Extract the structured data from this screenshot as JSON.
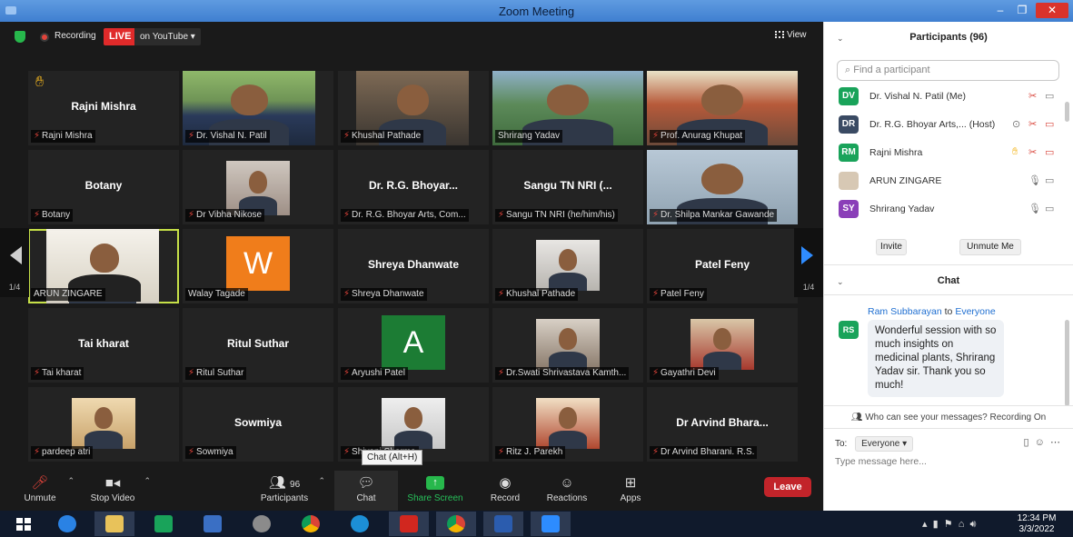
{
  "window": {
    "title": "Zoom Meeting",
    "min": "–",
    "max": "❐",
    "close": "✕"
  },
  "top_bar": {
    "recording": "Recording",
    "live": "LIVE",
    "youtube": "on YouTube ▾",
    "view": "View"
  },
  "tiles": [
    {
      "center": "Rajni Mishra",
      "label": "Rajni Mishra",
      "muted": true,
      "hand": true
    },
    {
      "center": "",
      "label": "Dr. Vishal N. Patil",
      "muted": true
    },
    {
      "center": "",
      "label": "Khushal Pathade",
      "muted": true
    },
    {
      "center": "",
      "label": "Shrirang Yadav",
      "muted": false
    },
    {
      "center": "",
      "label": "Prof. Anurag Khupat",
      "muted": true
    },
    {
      "center": "Botany",
      "label": "Botany",
      "muted": true
    },
    {
      "center": "",
      "label": "Dr Vibha Nikose",
      "muted": true
    },
    {
      "center": "Dr. R.G. Bhoyar...",
      "label": "Dr. R.G. Bhoyar Arts, Com...",
      "muted": true
    },
    {
      "center": "Sangu TN NRI (...",
      "label": "Sangu TN NRI (he/him/his)",
      "muted": true
    },
    {
      "center": "",
      "label": "Dr. Shilpa Mankar Gawande",
      "muted": true
    },
    {
      "center": "",
      "label": "ARUN ZINGARE",
      "muted": false
    },
    {
      "center": "",
      "label": "Walay Tagade",
      "muted": false,
      "letter": "W"
    },
    {
      "center": "Shreya Dhanwate",
      "label": "Shreya Dhanwate",
      "muted": true
    },
    {
      "center": "",
      "label": "Khushal Pathade",
      "muted": true
    },
    {
      "center": "Patel Feny",
      "label": "Patel Feny",
      "muted": true
    },
    {
      "center": "Tai kharat",
      "label": "Tai kharat",
      "muted": true
    },
    {
      "center": "Ritul Suthar",
      "label": "Ritul Suthar",
      "muted": true
    },
    {
      "center": "",
      "label": "Aryushi Patel",
      "muted": true,
      "letter": "A"
    },
    {
      "center": "",
      "label": "Dr.Swati Shrivastava Kamth...",
      "muted": true
    },
    {
      "center": "",
      "label": "Gayathri Devi",
      "muted": true
    },
    {
      "center": "",
      "label": "pardeep atri",
      "muted": true
    },
    {
      "center": "Sowmiya",
      "label": "Sowmiya",
      "muted": true
    },
    {
      "center": "",
      "label": "Shivani Sharma",
      "muted": true
    },
    {
      "center": "",
      "label": "Ritz J. Parekh",
      "muted": true
    },
    {
      "center": "Dr Arvind Bhara...",
      "label": "Dr Arvind Bharani. R.S.",
      "muted": true
    }
  ],
  "paging": {
    "left": "1/4",
    "right": "1/4"
  },
  "toolbar": {
    "unmute": "Unmute",
    "stop_video": "Stop Video",
    "participants": "Participants",
    "participants_count": "96",
    "chat": "Chat",
    "share": "Share Screen",
    "record": "Record",
    "reactions": "Reactions",
    "apps": "Apps",
    "leave": "Leave",
    "tooltip": "Chat (Alt+H)"
  },
  "participants_panel": {
    "title": "Participants (96)",
    "search_placeholder": "Find a participant",
    "rows": [
      {
        "initials": "DV",
        "color": "#19a35a",
        "name": "Dr. Vishal N. Patil (Me)"
      },
      {
        "initials": "DR",
        "color": "#3a4a63",
        "name": "Dr. R.G. Bhoyar Arts,... (Host)"
      },
      {
        "initials": "RM",
        "color": "#19a35a",
        "name": "Rajni Mishra"
      },
      {
        "initials": "",
        "color": "#d7c8b4",
        "name": "ARUN ZINGARE"
      },
      {
        "initials": "SY",
        "color": "#8a3fb8",
        "name": "Shrirang Yadav"
      }
    ],
    "invite": "Invite",
    "unmute_me": "Unmute Me"
  },
  "chat_panel": {
    "title": "Chat",
    "from": "Ram Subbarayan",
    "to_word": "to",
    "to": "Everyone",
    "sender_initials": "RS",
    "message": "Wonderful session with so much insights on medicinal plants, Shrirang Yadav sir. Thank you so much!",
    "notice": "Who can see your messages? Recording On",
    "to_label": "To:",
    "to_select": "Everyone ▾",
    "placeholder": "Type message here..."
  },
  "taskbar": {
    "time": "12:34 PM",
    "date": "3/3/2022"
  }
}
